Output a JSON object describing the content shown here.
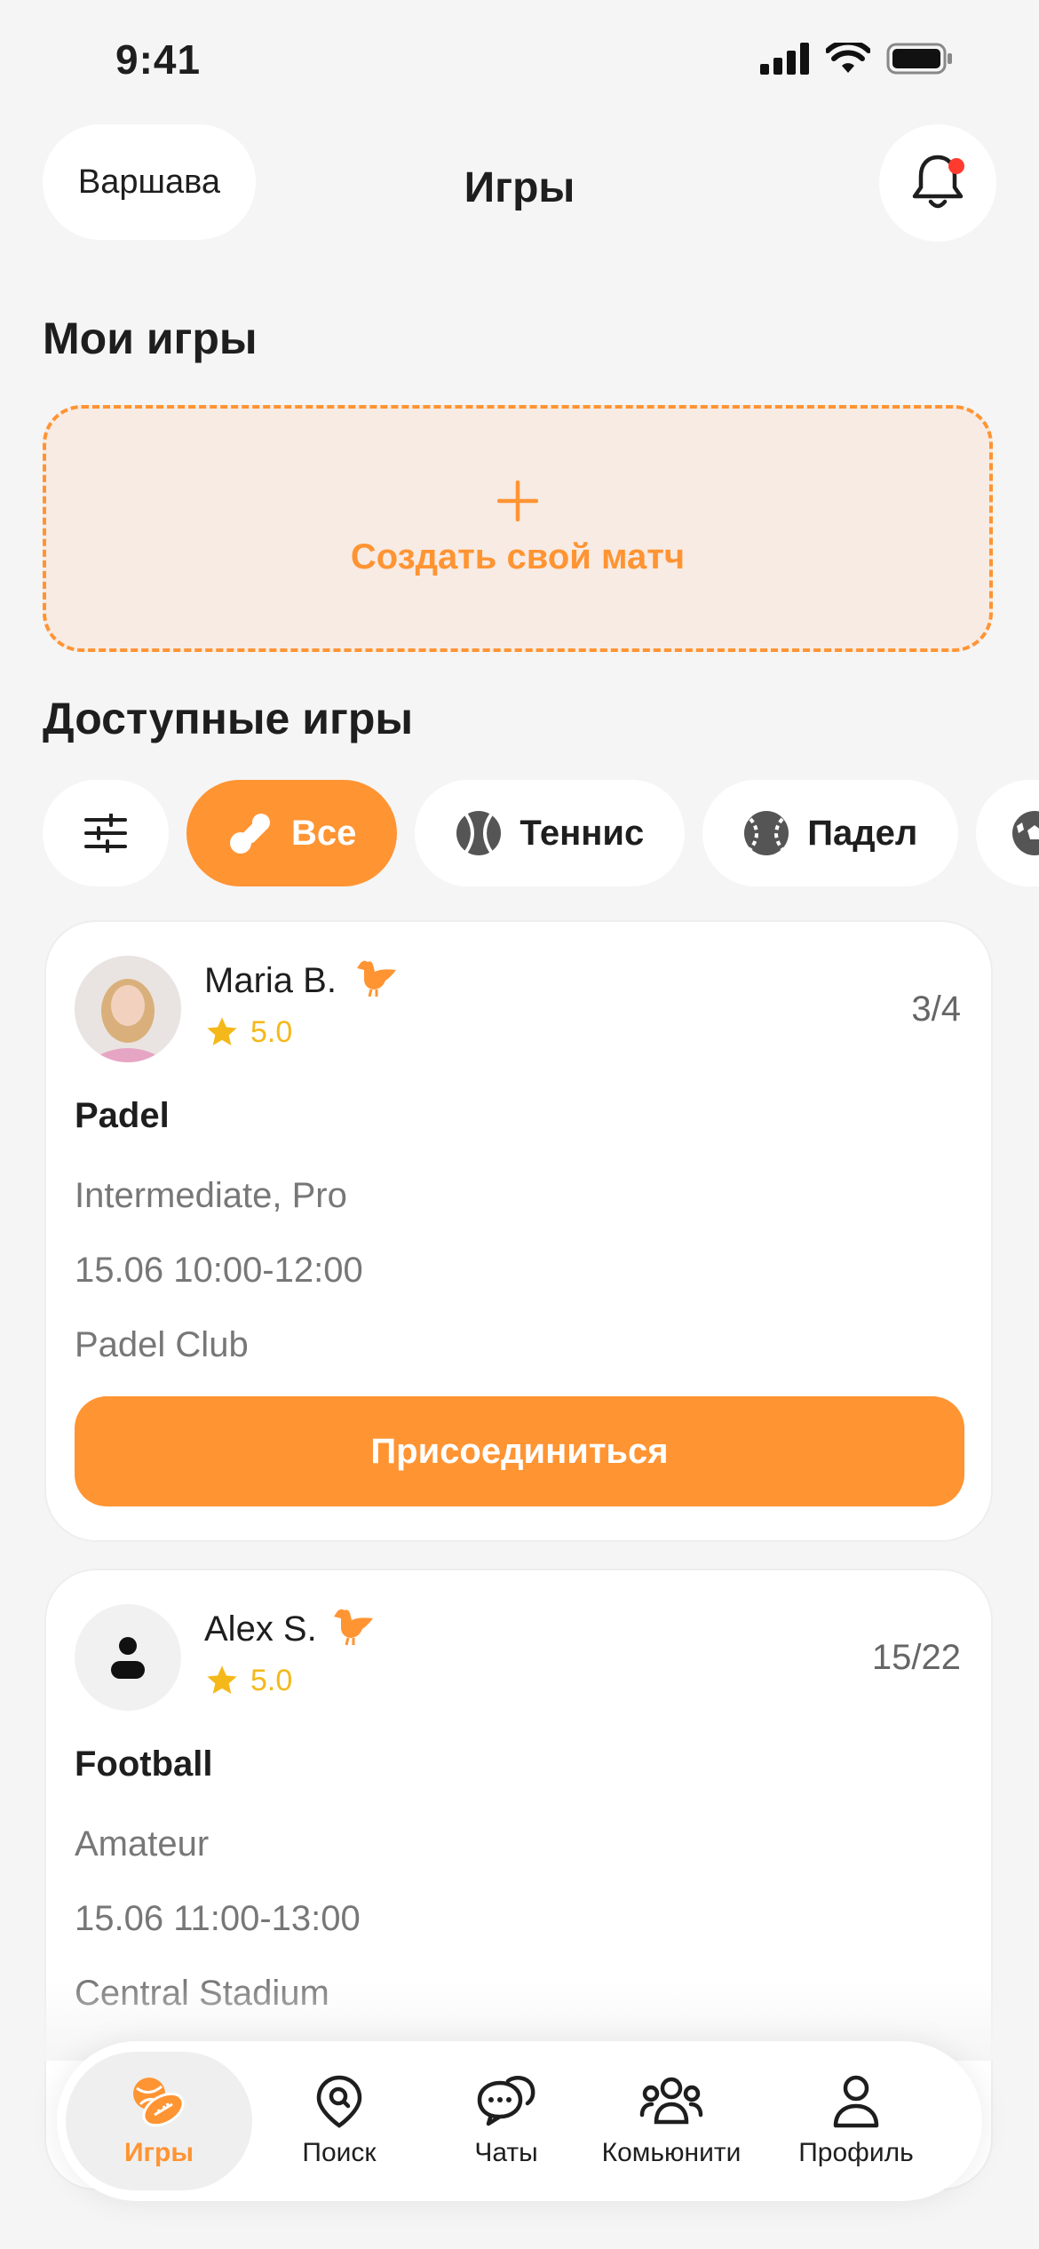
{
  "status_bar": {
    "time": "9:41"
  },
  "header": {
    "city": "Варшава",
    "title": "Игры"
  },
  "my_games": {
    "title": "Мои игры",
    "create_label": "Создать свой матч"
  },
  "available": {
    "title": "Доступные игры",
    "filters": [
      {
        "label": "Все",
        "icon": "sports-icon",
        "active": true
      },
      {
        "label": "Теннис",
        "icon": "tennis-ball-icon",
        "active": false
      },
      {
        "label": "Падел",
        "icon": "padel-ball-icon",
        "active": false
      }
    ]
  },
  "games": [
    {
      "player": "Maria B.",
      "rating": "5.0",
      "slots": "3/4",
      "sport": "Padel",
      "level": "Intermediate, Pro",
      "time": "15.06 10:00-12:00",
      "place": "Padel Club",
      "join_label": "Присоединиться"
    },
    {
      "player": "Alex S.",
      "rating": "5.0",
      "slots": "15/22",
      "sport": "Football",
      "level": "Amateur",
      "time": "15.06 11:00-13:00",
      "place": "Central Stadium"
    }
  ],
  "nav": [
    {
      "label": "Игры",
      "icon": "games-icon",
      "active": true
    },
    {
      "label": "Поиск",
      "icon": "location-search-icon",
      "active": false
    },
    {
      "label": "Чаты",
      "icon": "chat-icon",
      "active": false
    },
    {
      "label": "Комьюнити",
      "icon": "community-icon",
      "active": false
    },
    {
      "label": "Профиль",
      "icon": "profile-icon",
      "active": false
    }
  ],
  "colors": {
    "accent": "#ff9433",
    "star": "#f4b81a",
    "background": "#f5f5f5",
    "notification": "#ff3b30"
  }
}
